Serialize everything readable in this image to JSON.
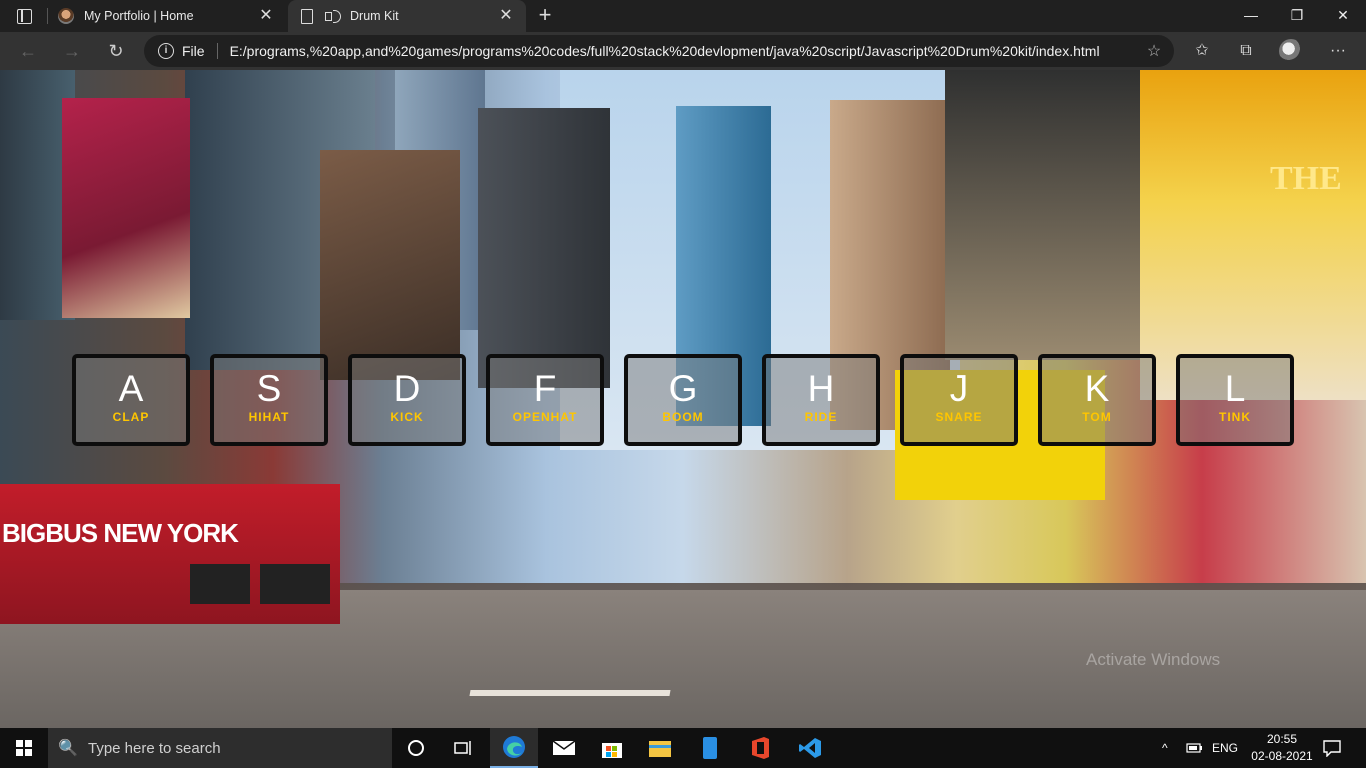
{
  "browser": {
    "tabs": [
      {
        "title": "My Portfolio | Home",
        "favicon": "avatar-icon",
        "active": false
      },
      {
        "title": "Drum Kit",
        "favicon": "page-icon",
        "active": true,
        "audio": "speaker-icon"
      }
    ],
    "close_glyph": "✕",
    "new_tab_glyph": "+",
    "window_controls": {
      "minimize": "—",
      "maximize": "❐",
      "close": "✕"
    },
    "nav": {
      "back": "←",
      "forward": "→",
      "reload": "↻"
    },
    "address": {
      "info": "i",
      "scheme_label": "File",
      "url": "E:/programs,%20app,and%20games/programs%20codes/full%20stack%20devlopment/java%20script/Javascript%20Drum%20kit/index.html",
      "favorite_add": "☆"
    },
    "toolbar": {
      "favorites": "✩",
      "collections": "⧉",
      "more": "···"
    }
  },
  "page": {
    "background_art": {
      "bus_text": "BIGBUS NEW YORK",
      "billboard_text": "THE"
    },
    "drums": [
      {
        "key": "A",
        "sound": "CLAP"
      },
      {
        "key": "S",
        "sound": "HIHAT"
      },
      {
        "key": "D",
        "sound": "KICK"
      },
      {
        "key": "F",
        "sound": "OPENHAT"
      },
      {
        "key": "G",
        "sound": "BOOM"
      },
      {
        "key": "H",
        "sound": "RIDE"
      },
      {
        "key": "J",
        "sound": "SNARE"
      },
      {
        "key": "K",
        "sound": "TOM"
      },
      {
        "key": "L",
        "sound": "TINK"
      }
    ],
    "watermark": "Activate Windows",
    "colors": {
      "key_text": "#ffffff",
      "sound_text": "#ffc600",
      "border": "#0d0d0d"
    }
  },
  "taskbar": {
    "search_placeholder": "Type here to search",
    "search_icon": "🔍",
    "tray": {
      "chevron": "^",
      "language": "ENG"
    },
    "time": "20:55",
    "date": "02-08-2021",
    "apps": [
      "cortana-icon",
      "task-view-icon",
      "edge-icon",
      "mail-icon",
      "store-icon",
      "file-explorer-icon",
      "phone-icon",
      "office-icon",
      "vscode-icon"
    ]
  }
}
